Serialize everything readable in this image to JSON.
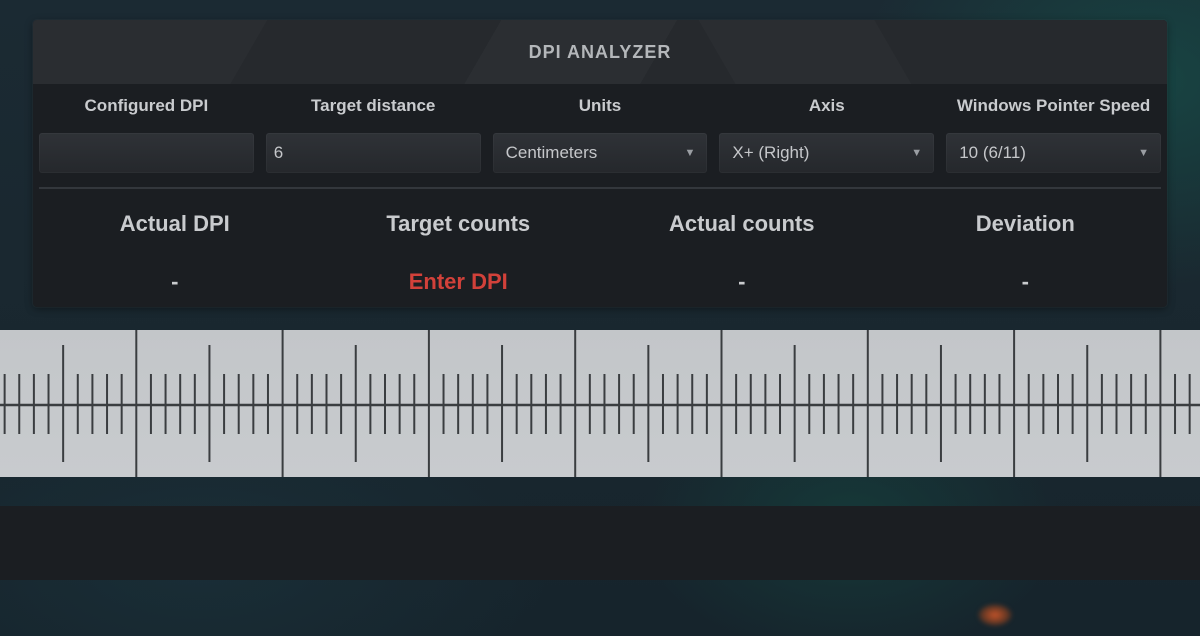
{
  "panel": {
    "title": "DPI ANALYZER"
  },
  "form": {
    "fields": [
      {
        "label": "Configured DPI",
        "value": "",
        "type": "input"
      },
      {
        "label": "Target distance",
        "value": "6",
        "type": "input"
      },
      {
        "label": "Units",
        "value": "Centimeters",
        "type": "select",
        "icon": "dropdown-arrow-icon"
      },
      {
        "label": "Axis",
        "value": "X+ (Right)",
        "type": "select",
        "icon": "dropdown-arrow-icon"
      },
      {
        "label": "Windows Pointer Speed",
        "value": "10 (6/11)",
        "type": "select",
        "icon": "dropdown-arrow-icon"
      }
    ]
  },
  "results": [
    {
      "label": "Actual DPI",
      "value": "-"
    },
    {
      "label": "Target counts",
      "value": "Enter DPI",
      "status": "error"
    },
    {
      "label": "Actual counts",
      "value": "-"
    },
    {
      "label": "Deviation",
      "value": "-"
    }
  ],
  "ruler": {
    "unit": "Centimeters",
    "subdivisions_per_unit": 10,
    "visible_units": 9
  },
  "colors": {
    "error": "#d2413a",
    "panel_bg": "#1b1e22",
    "ruler_bg": "#c5c8cb",
    "ruler_ink": "#3a3d40"
  },
  "icons": {
    "dropdown": "▼"
  }
}
